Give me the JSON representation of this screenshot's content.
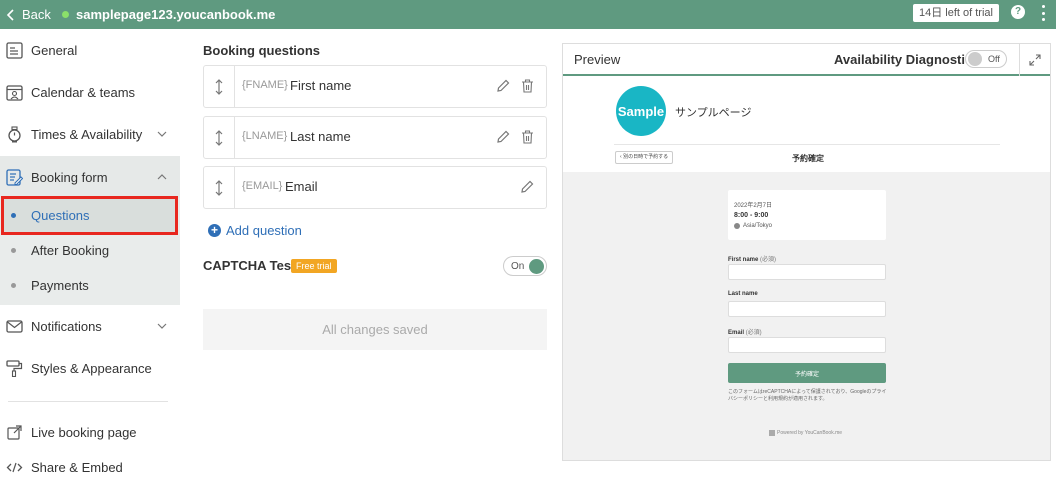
{
  "topbar": {
    "back_label": "Back",
    "site_url": "samplepage123.youcanbook.me",
    "trial_label": "14日 left of trial",
    "help_label": "?"
  },
  "sidebar": {
    "items": [
      {
        "label": "General",
        "icon": "general-icon"
      },
      {
        "label": "Calendar & teams",
        "icon": "calendar-icon"
      },
      {
        "label": "Times & Availability",
        "icon": "clock-icon"
      },
      {
        "label": "Booking form",
        "icon": "form-icon"
      },
      {
        "label": "Notifications",
        "icon": "mail-icon"
      },
      {
        "label": "Styles & Appearance",
        "icon": "paint-roller-icon"
      },
      {
        "label": "Live booking page",
        "icon": "external-link-icon"
      },
      {
        "label": "Share & Embed",
        "icon": "code-icon"
      }
    ],
    "booking_form_subitems": [
      {
        "label": "Questions",
        "active": true
      },
      {
        "label": "After Booking",
        "active": false
      },
      {
        "label": "Payments",
        "active": false
      }
    ]
  },
  "main": {
    "section_title": "Booking questions",
    "questions": [
      {
        "tag": "{FNAME}",
        "name": "First name",
        "deletable": true
      },
      {
        "tag": "{LNAME}",
        "name": "Last name",
        "deletable": true
      },
      {
        "tag": "{EMAIL}",
        "name": "Email",
        "deletable": false
      }
    ],
    "add_question_label": "Add question",
    "captcha_label": "CAPTCHA Test",
    "captcha_badge": "Free trial",
    "captcha_toggle_label": "On",
    "captcha_enabled": true,
    "saved_label": "All changes saved"
  },
  "preview": {
    "title": "Preview",
    "diagnostics_label": "Availability Diagnostics",
    "diagnostics_toggle_label": "Off",
    "diagnostics_enabled": false,
    "logo_text": "Sample",
    "page_name": "サンプルページ",
    "back_button": "別の日時で予約する",
    "confirm_title": "予約確定",
    "booking_date": "2022年2月7日",
    "booking_time": "8:00 - 9:00",
    "timezone": "Asia/Tokyo",
    "fields": [
      {
        "label": "First name",
        "required": "(必須)"
      },
      {
        "label": "Last name",
        "required": ""
      },
      {
        "label": "Email",
        "required": "(必須)"
      }
    ],
    "submit_label": "予約確定",
    "captcha_notice": "このフォームはreCAPTCHAによって保護されており、Googleのプライバシーポリシーと利用規約が適用されます。",
    "powered_by": "Powered by YouCanBook.me"
  },
  "colors": {
    "topbar": "#5f9a80",
    "accent_blue": "#2f6fb7",
    "highlight_red": "#e8271f",
    "badge_orange": "#f2a623",
    "logo_teal": "#19b6c5"
  }
}
